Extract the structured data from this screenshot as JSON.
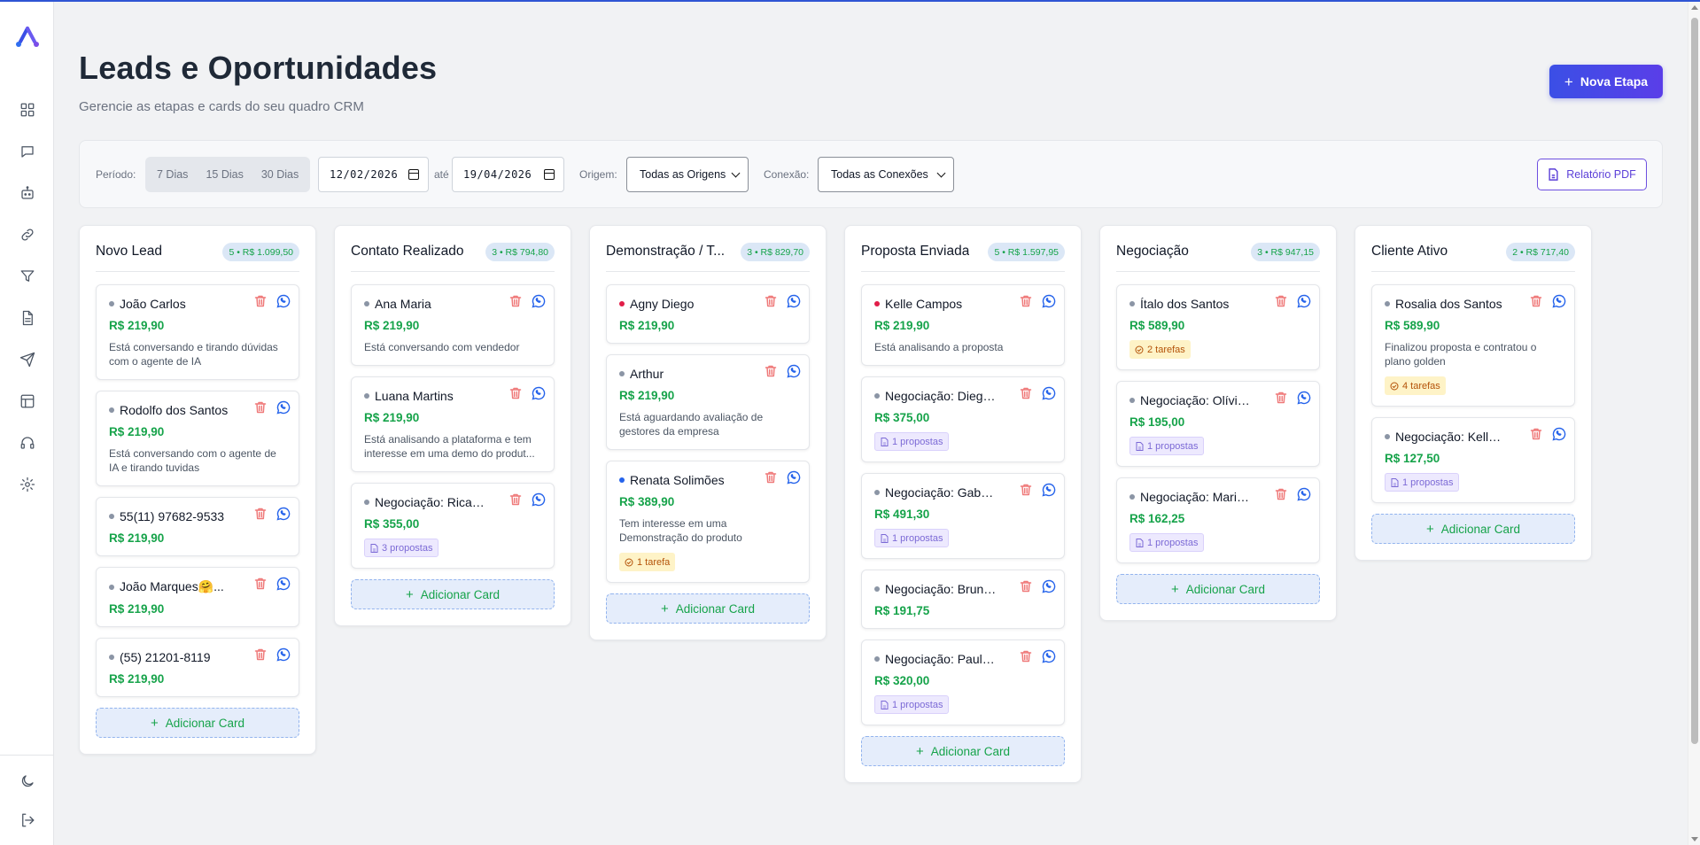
{
  "app": {
    "accent": "#3b4fe6",
    "success": "#16a34a"
  },
  "sidebar": {
    "items": [
      {
        "name": "grid-icon"
      },
      {
        "name": "chat-icon"
      },
      {
        "name": "robot-icon"
      },
      {
        "name": "link-icon"
      },
      {
        "name": "filter-icon"
      },
      {
        "name": "document-icon"
      },
      {
        "name": "send-icon"
      },
      {
        "name": "layout-icon"
      },
      {
        "name": "headset-icon"
      },
      {
        "name": "gear-icon"
      }
    ],
    "bottom": [
      {
        "name": "moon-icon"
      },
      {
        "name": "logout-icon"
      }
    ]
  },
  "header": {
    "title": "Leads e Oportunidades",
    "subtitle": "Gerencie as etapas e cards do seu quadro CRM",
    "new_stage_label": "Nova Etapa"
  },
  "filters": {
    "period_label": "Período:",
    "period_options": [
      "7 Dias",
      "15 Dias",
      "30 Dias"
    ],
    "date_from": "12/02/2026",
    "until_label": "até",
    "date_to": "19/04/2026",
    "origin_label": "Origem:",
    "origin_value": "Todas as Origens",
    "connection_label": "Conexão:",
    "connection_value": "Todas as Conexões",
    "pdf_label": "Relatório PDF"
  },
  "add_card_label": "Adicionar Card",
  "columns": [
    {
      "title": "Novo Lead",
      "badge": "5 • R$ 1.099,50",
      "cards": [
        {
          "name": "João Carlos",
          "dot": "#8b95a5",
          "price": "R$ 219,90",
          "desc": "Está conversando e tirando dúvidas com o agente de IA"
        },
        {
          "name": "Rodolfo dos Santos",
          "dot": "#8b95a5",
          "price": "R$ 219,90",
          "desc": "Está conversando com o agente de IA e tirando tuvidas"
        },
        {
          "name": "55(11) 97682-9533",
          "dot": "#8b95a5",
          "price": "R$ 219,90"
        },
        {
          "name": "João Marques🤗...",
          "dot": "#8b95a5",
          "price": "R$ 219,90"
        },
        {
          "name": "(55) 21201-8119",
          "dot": "#8b95a5",
          "price": "R$ 219,90"
        }
      ]
    },
    {
      "title": "Contato Realizado",
      "badge": "3 • R$ 794,80",
      "cards": [
        {
          "name": "Ana Maria",
          "dot": "#8b95a5",
          "price": "R$ 219,90",
          "desc": "Está conversando com vendedor"
        },
        {
          "name": "Luana Martins",
          "dot": "#8b95a5",
          "price": "R$ 219,90",
          "desc": "Está analisando a plataforma e tem interesse em uma demo do produt..."
        },
        {
          "name": "Negociação: Ricard...",
          "dot": "#8b95a5",
          "price": "R$ 355,00",
          "tag": "3 propostas",
          "tag_type": "props"
        }
      ]
    },
    {
      "title": "Demonstração / T...",
      "badge": "3 • R$ 829,70",
      "cards": [
        {
          "name": "Agny Diego",
          "dot": "#e11d48",
          "price": "R$ 219,90"
        },
        {
          "name": "Arthur",
          "dot": "#8b95a5",
          "price": "R$ 219,90",
          "desc": "Está aguardando avaliação de gestores da empresa"
        },
        {
          "name": "Renata Solimões",
          "dot": "#2563eb",
          "price": "R$ 389,90",
          "desc": "Tem interesse em uma Demonstração do produto",
          "tag": "1 tarefa",
          "tag_type": "tasks"
        }
      ]
    },
    {
      "title": "Proposta Enviada",
      "badge": "5 • R$ 1.597,95",
      "cards": [
        {
          "name": "Kelle Campos",
          "dot": "#e11d48",
          "price": "R$ 219,90",
          "desc": "Está analisando a proposta"
        },
        {
          "name": "Negociação: Diego...",
          "dot": "#8b95a5",
          "price": "R$ 375,00",
          "tag": "1 propostas",
          "tag_type": "props"
        },
        {
          "name": "Negociação: Gabri...",
          "dot": "#8b95a5",
          "price": "R$ 491,30",
          "tag": "1 propostas",
          "tag_type": "props"
        },
        {
          "name": "Negociação: Bruno...",
          "dot": "#8b95a5",
          "price": "R$ 191,75"
        },
        {
          "name": "Negociação: Paulo ...",
          "dot": "#8b95a5",
          "price": "R$ 320,00",
          "tag": "1 propostas",
          "tag_type": "props"
        }
      ]
    },
    {
      "title": "Negociação",
      "badge": "3 • R$ 947,15",
      "cards": [
        {
          "name": "Ítalo dos Santos",
          "dot": "#8b95a5",
          "price": "R$ 589,90",
          "tag": "2 tarefas",
          "tag_type": "tasks"
        },
        {
          "name": "Negociação: Olívia ...",
          "dot": "#8b95a5",
          "price": "R$ 195,00",
          "tag": "1 propostas",
          "tag_type": "props"
        },
        {
          "name": "Negociação: Maria...",
          "dot": "#8b95a5",
          "price": "R$ 162,25",
          "tag": "1 propostas",
          "tag_type": "props"
        }
      ]
    },
    {
      "title": "Cliente Ativo",
      "badge": "2 • R$ 717,40",
      "cards": [
        {
          "name": "Rosalia dos Santos",
          "dot": "#8b95a5",
          "price": "R$ 589,90",
          "desc": "Finalizou proposta e contratou o plano golden",
          "tag": "4 tarefas",
          "tag_type": "tasks"
        },
        {
          "name": "Negociação: Kelly ...",
          "dot": "#8b95a5",
          "price": "R$ 127,50",
          "tag": "1 propostas",
          "tag_type": "props"
        }
      ]
    }
  ]
}
